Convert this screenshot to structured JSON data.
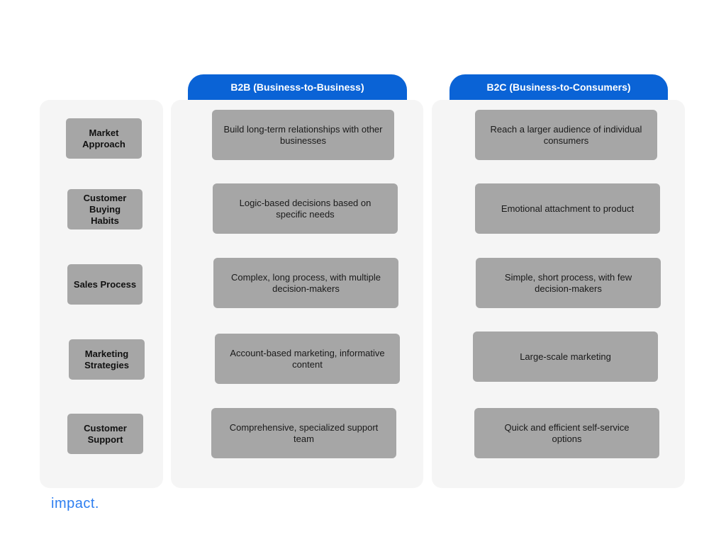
{
  "headers": {
    "b2b": "B2B (Business-to-Business)",
    "b2c": "B2C (Business-to-Consumers)"
  },
  "rows": [
    {
      "label": "Market Approach",
      "b2b": "Build long-term relationships with other businesses",
      "b2c": "Reach a larger audience of individual consumers"
    },
    {
      "label": "Customer Buying Habits",
      "b2b": "Logic-based decisions based on specific needs",
      "b2c": "Emotional attachment to product"
    },
    {
      "label": "Sales Process",
      "b2b": "Complex, long process, with multiple decision-makers",
      "b2c": "Simple, short process, with few decision-makers"
    },
    {
      "label": "Marketing Strategies",
      "b2b": "Account-based marketing, informative content",
      "b2c": "Large-scale marketing"
    },
    {
      "label": "Customer Support",
      "b2b": "Comprehensive, specialized support team",
      "b2c": "Quick and efficient self-service options"
    }
  ],
  "logo": "impact.",
  "colors": {
    "accent": "#0a63d6",
    "box": "#a6a6a6",
    "panel": "#f5f5f5",
    "logo": "#2d7ef0"
  }
}
